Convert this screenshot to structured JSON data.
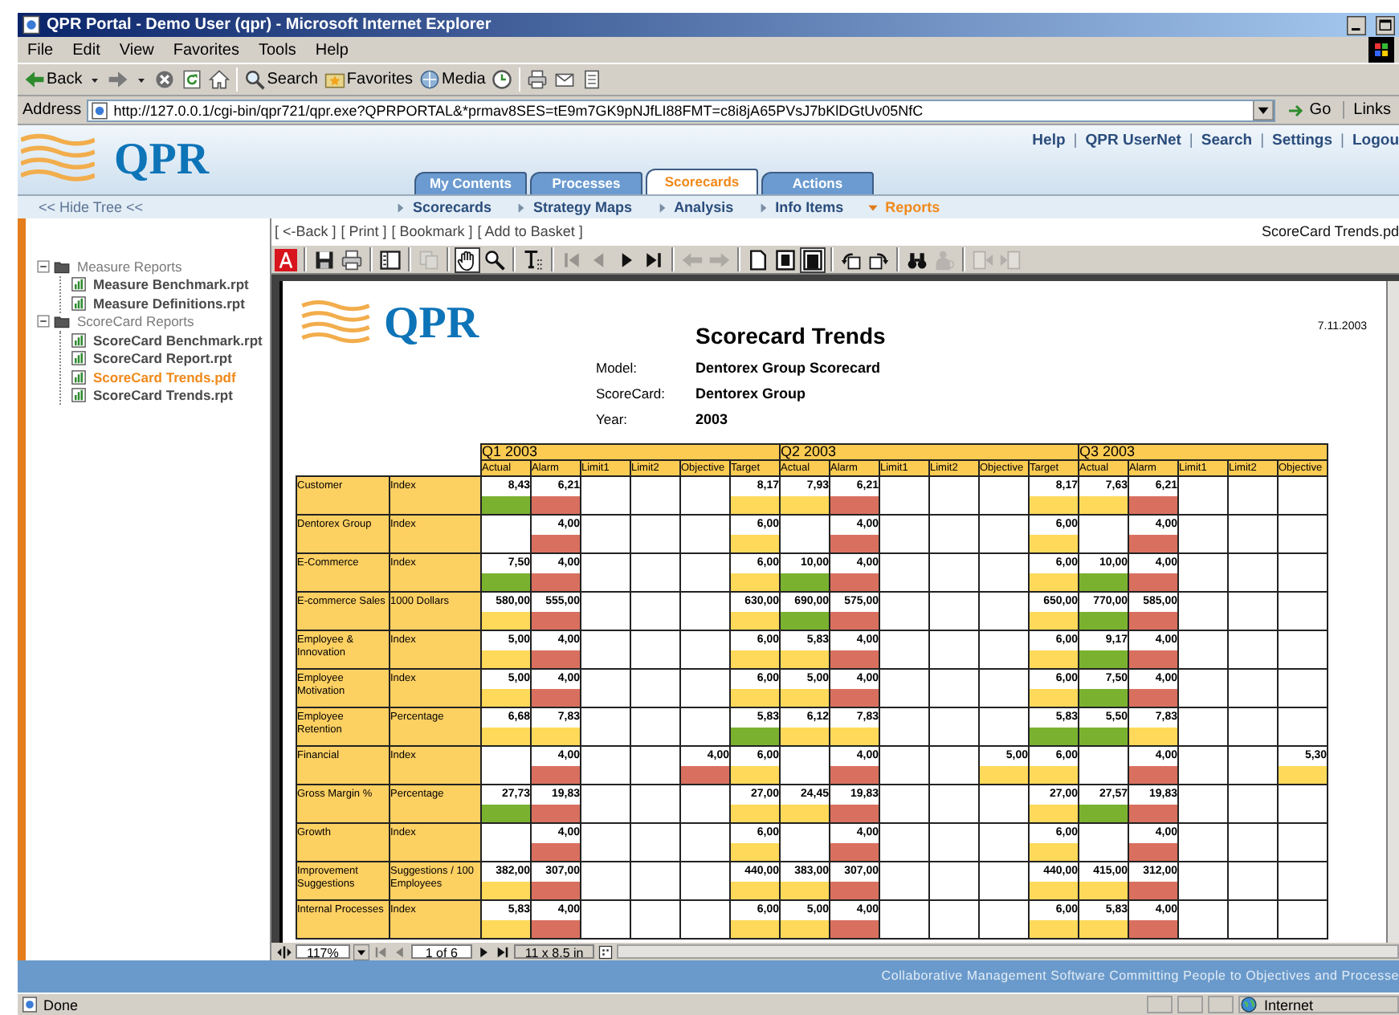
{
  "window": {
    "title": "QPR Portal - Demo User (qpr) - Microsoft Internet Explorer"
  },
  "menu": [
    "File",
    "Edit",
    "View",
    "Favorites",
    "Tools",
    "Help"
  ],
  "ie_toolbar": [
    {
      "kind": "back",
      "label": "Back"
    },
    {
      "kind": "forward"
    },
    {
      "kind": "stop"
    },
    {
      "kind": "refresh"
    },
    {
      "kind": "home"
    },
    {
      "kind": "search",
      "label": "Search"
    },
    {
      "kind": "favorites",
      "label": "Favorites"
    },
    {
      "kind": "media",
      "label": "Media"
    },
    {
      "kind": "history"
    },
    {
      "kind": "print"
    },
    {
      "kind": "mail"
    },
    {
      "kind": "edit"
    }
  ],
  "address": {
    "label": "Address",
    "url": "http://127.0.0.1/cgi-bin/qpr721/qpr.exe?QPRPORTAL&*prmav8SES=tE9m7GK9pNJfLI88FMT=c8i8jA65PVsJ7bKlDGtUv05NfC",
    "go": "Go",
    "links": "Links"
  },
  "portal": {
    "logo": "QPR",
    "links": [
      {
        "kind": "link",
        "label": "Help"
      },
      {
        "kind": "sep",
        "label": "|"
      },
      {
        "kind": "link",
        "label": "QPR UserNet"
      },
      {
        "kind": "sep",
        "label": "|"
      },
      {
        "kind": "link",
        "label": "Search"
      },
      {
        "kind": "sep",
        "label": "|"
      },
      {
        "kind": "link",
        "label": "Settings"
      },
      {
        "kind": "sep",
        "label": "|"
      },
      {
        "kind": "link",
        "label": "Logou"
      }
    ],
    "tabs": [
      {
        "label": "My Contents",
        "selected": false
      },
      {
        "label": "Processes",
        "selected": false
      },
      {
        "label": "Scorecards",
        "selected": true
      },
      {
        "label": "Actions",
        "selected": false
      }
    ],
    "hide_tree": "<< Hide Tree <<",
    "subnav": [
      {
        "label": "Scorecards",
        "selected": false
      },
      {
        "label": "Strategy Maps",
        "selected": false
      },
      {
        "label": "Analysis",
        "selected": false
      },
      {
        "label": "Info Items",
        "selected": false
      },
      {
        "label": "Reports",
        "selected": true
      }
    ]
  },
  "tree": [
    {
      "label": "Measure Reports",
      "expanded": true,
      "children": [
        {
          "label": "Measure Benchmark.rpt",
          "selected": false
        },
        {
          "label": "Measure Definitions.rpt",
          "selected": false
        }
      ]
    },
    {
      "label": "ScoreCard Reports",
      "expanded": true,
      "children": [
        {
          "label": "ScoreCard Benchmark.rpt",
          "selected": false
        },
        {
          "label": "ScoreCard Report.rpt",
          "selected": false
        },
        {
          "label": "ScoreCard Trends.pdf",
          "selected": true
        },
        {
          "label": "ScoreCard Trends.rpt",
          "selected": false
        }
      ]
    }
  ],
  "viewer": {
    "links": [
      "[ <-Back ]",
      "[ Print ]",
      "[ Bookmark ]",
      "[ Add to Basket ]"
    ],
    "file": "ScoreCard Trends.pd",
    "toolbar": [
      {
        "kind": "acrobat",
        "disabled": false,
        "pressed": false
      },
      {
        "kind": "sep"
      },
      {
        "kind": "save",
        "disabled": false,
        "pressed": false
      },
      {
        "kind": "print",
        "disabled": false,
        "pressed": false
      },
      {
        "kind": "sep"
      },
      {
        "kind": "panel",
        "disabled": false,
        "pressed": false
      },
      {
        "kind": "sep"
      },
      {
        "kind": "copy",
        "disabled": true,
        "pressed": false
      },
      {
        "kind": "sep"
      },
      {
        "kind": "hand",
        "disabled": false,
        "pressed": true
      },
      {
        "kind": "zoom",
        "disabled": false,
        "pressed": false
      },
      {
        "kind": "sep"
      },
      {
        "kind": "textselect",
        "disabled": false,
        "pressed": false
      },
      {
        "kind": "sep"
      },
      {
        "kind": "first",
        "disabled": true,
        "pressed": false
      },
      {
        "kind": "prev",
        "disabled": true,
        "pressed": false
      },
      {
        "kind": "next",
        "disabled": false,
        "pressed": false
      },
      {
        "kind": "last",
        "disabled": false,
        "pressed": false
      },
      {
        "kind": "sep"
      },
      {
        "kind": "goback",
        "disabled": true,
        "pressed": false
      },
      {
        "kind": "goforward",
        "disabled": true,
        "pressed": false
      },
      {
        "kind": "sep"
      },
      {
        "kind": "actual",
        "disabled": false,
        "pressed": false
      },
      {
        "kind": "fitpage",
        "disabled": false,
        "pressed": false
      },
      {
        "kind": "fitwidth",
        "disabled": false,
        "pressed": true
      },
      {
        "kind": "sep"
      },
      {
        "kind": "rotl",
        "disabled": false,
        "pressed": false
      },
      {
        "kind": "rotr",
        "disabled": false,
        "pressed": false
      },
      {
        "kind": "sep"
      },
      {
        "kind": "find",
        "disabled": false,
        "pressed": false
      },
      {
        "kind": "person",
        "disabled": true,
        "pressed": false
      },
      {
        "kind": "sep"
      },
      {
        "kind": "read1",
        "disabled": true,
        "pressed": false
      },
      {
        "kind": "read2",
        "disabled": true,
        "pressed": false
      }
    ],
    "zoom": "117%",
    "page": "1 of 6",
    "size": "11 x 8.5 in"
  },
  "report": {
    "logo": "QPR",
    "title": "Scorecard Trends",
    "date": "7.11.2003",
    "fields": [
      {
        "label": "Model:",
        "value": "Dentorex Group Scorecard"
      },
      {
        "label": "ScoreCard:",
        "value": "Dentorex Group"
      },
      {
        "label": "Year:",
        "value": "2003"
      }
    ],
    "quarters": [
      {
        "label": "Q1 2003",
        "columns": [
          "Actual",
          "Alarm",
          "Limit1",
          "Limit2",
          "Objective",
          "Target"
        ]
      },
      {
        "label": "Q2 2003",
        "columns": [
          "Actual",
          "Alarm",
          "Limit1",
          "Limit2",
          "Objective",
          "Target"
        ]
      },
      {
        "label": "Q3 2003",
        "columns": [
          "Actual",
          "Alarm",
          "Limit1",
          "Limit2",
          "Objective"
        ]
      }
    ],
    "rows": [
      {
        "measure": "Customer",
        "unit": "Index",
        "cells": [
          {
            "value": "8,43",
            "color": "#7ab230"
          },
          {
            "value": "6,21",
            "color": "#d9705f"
          },
          null,
          null,
          null,
          {
            "value": "8,17",
            "color": "#ffd95a"
          },
          {
            "value": "7,93",
            "color": "#ffd95a"
          },
          {
            "value": "6,21",
            "color": "#d9705f"
          },
          null,
          null,
          null,
          {
            "value": "8,17",
            "color": "#ffd95a"
          },
          {
            "value": "7,63",
            "color": "#ffd95a"
          },
          {
            "value": "6,21",
            "color": "#d9705f"
          },
          null,
          null,
          null
        ]
      },
      {
        "measure": "Dentorex Group",
        "unit": "Index",
        "cells": [
          null,
          {
            "value": "4,00",
            "color": "#d9705f"
          },
          null,
          null,
          null,
          {
            "value": "6,00",
            "color": "#ffd95a"
          },
          null,
          {
            "value": "4,00",
            "color": "#d9705f"
          },
          null,
          null,
          null,
          {
            "value": "6,00",
            "color": "#ffd95a"
          },
          null,
          {
            "value": "4,00",
            "color": "#d9705f"
          },
          null,
          null,
          null
        ]
      },
      {
        "measure": "E-Commerce",
        "unit": "Index",
        "cells": [
          {
            "value": "7,50",
            "color": "#7ab230"
          },
          {
            "value": "4,00",
            "color": "#d9705f"
          },
          null,
          null,
          null,
          {
            "value": "6,00",
            "color": "#ffd95a"
          },
          {
            "value": "10,00",
            "color": "#7ab230"
          },
          {
            "value": "4,00",
            "color": "#d9705f"
          },
          null,
          null,
          null,
          {
            "value": "6,00",
            "color": "#ffd95a"
          },
          {
            "value": "10,00",
            "color": "#7ab230"
          },
          {
            "value": "4,00",
            "color": "#d9705f"
          },
          null,
          null,
          null
        ]
      },
      {
        "measure": "E-commerce Sales",
        "unit": "1000 Dollars",
        "cells": [
          {
            "value": "580,00",
            "color": "#ffd95a"
          },
          {
            "value": "555,00",
            "color": "#d9705f"
          },
          null,
          null,
          null,
          {
            "value": "630,00",
            "color": "#ffd95a"
          },
          {
            "value": "690,00",
            "color": "#7ab230"
          },
          {
            "value": "575,00",
            "color": "#d9705f"
          },
          null,
          null,
          null,
          {
            "value": "650,00",
            "color": "#ffd95a"
          },
          {
            "value": "770,00",
            "color": "#7ab230"
          },
          {
            "value": "585,00",
            "color": "#d9705f"
          },
          null,
          null,
          null
        ]
      },
      {
        "measure": "Employee & Innovation",
        "unit": "Index",
        "cells": [
          {
            "value": "5,00",
            "color": "#ffd95a"
          },
          {
            "value": "4,00",
            "color": "#d9705f"
          },
          null,
          null,
          null,
          {
            "value": "6,00",
            "color": "#ffd95a"
          },
          {
            "value": "5,83",
            "color": "#ffd95a"
          },
          {
            "value": "4,00",
            "color": "#d9705f"
          },
          null,
          null,
          null,
          {
            "value": "6,00",
            "color": "#ffd95a"
          },
          {
            "value": "9,17",
            "color": "#7ab230"
          },
          {
            "value": "4,00",
            "color": "#d9705f"
          },
          null,
          null,
          null
        ]
      },
      {
        "measure": "Employee Motivation",
        "unit": "Index",
        "cells": [
          {
            "value": "5,00",
            "color": "#ffd95a"
          },
          {
            "value": "4,00",
            "color": "#d9705f"
          },
          null,
          null,
          null,
          {
            "value": "6,00",
            "color": "#ffd95a"
          },
          {
            "value": "5,00",
            "color": "#ffd95a"
          },
          {
            "value": "4,00",
            "color": "#d9705f"
          },
          null,
          null,
          null,
          {
            "value": "6,00",
            "color": "#ffd95a"
          },
          {
            "value": "7,50",
            "color": "#7ab230"
          },
          {
            "value": "4,00",
            "color": "#d9705f"
          },
          null,
          null,
          null
        ]
      },
      {
        "measure": "Employee Retention",
        "unit": "Percentage",
        "cells": [
          {
            "value": "6,68",
            "color": "#ffd95a"
          },
          {
            "value": "7,83",
            "color": "#ffd95a"
          },
          null,
          null,
          null,
          {
            "value": "5,83",
            "color": "#7ab230"
          },
          {
            "value": "6,12",
            "color": "#ffd95a"
          },
          {
            "value": "7,83",
            "color": "#ffd95a"
          },
          null,
          null,
          null,
          {
            "value": "5,83",
            "color": "#7ab230"
          },
          {
            "value": "5,50",
            "color": "#7ab230"
          },
          {
            "value": "7,83",
            "color": "#ffd95a"
          },
          null,
          null,
          null
        ]
      },
      {
        "measure": "Financial",
        "unit": "Index",
        "cells": [
          null,
          {
            "value": "4,00",
            "color": "#d9705f"
          },
          null,
          null,
          {
            "value": "4,00",
            "color": "#d9705f"
          },
          {
            "value": "6,00",
            "color": "#ffd95a"
          },
          null,
          {
            "value": "4,00",
            "color": "#d9705f"
          },
          null,
          null,
          {
            "value": "5,00",
            "color": "#ffd95a"
          },
          {
            "value": "6,00",
            "color": "#ffd95a"
          },
          null,
          {
            "value": "4,00",
            "color": "#d9705f"
          },
          null,
          null,
          {
            "value": "5,30",
            "color": "#ffd95a"
          }
        ]
      },
      {
        "measure": "Gross Margin %",
        "unit": "Percentage",
        "cells": [
          {
            "value": "27,73",
            "color": "#7ab230"
          },
          {
            "value": "19,83",
            "color": "#d9705f"
          },
          null,
          null,
          null,
          {
            "value": "27,00",
            "color": "#ffd95a"
          },
          {
            "value": "24,45",
            "color": "#ffd95a"
          },
          {
            "value": "19,83",
            "color": "#d9705f"
          },
          null,
          null,
          null,
          {
            "value": "27,00",
            "color": "#ffd95a"
          },
          {
            "value": "27,57",
            "color": "#7ab230"
          },
          {
            "value": "19,83",
            "color": "#d9705f"
          },
          null,
          null,
          null
        ]
      },
      {
        "measure": "Growth",
        "unit": "Index",
        "cells": [
          null,
          {
            "value": "4,00",
            "color": "#d9705f"
          },
          null,
          null,
          null,
          {
            "value": "6,00",
            "color": "#ffd95a"
          },
          null,
          {
            "value": "4,00",
            "color": "#d9705f"
          },
          null,
          null,
          null,
          {
            "value": "6,00",
            "color": "#ffd95a"
          },
          null,
          {
            "value": "4,00",
            "color": "#d9705f"
          },
          null,
          null,
          null
        ]
      },
      {
        "measure": "Improvement Suggestions",
        "unit": "Suggestions / 100 Employees",
        "cells": [
          {
            "value": "382,00",
            "color": "#ffd95a"
          },
          {
            "value": "307,00",
            "color": "#d9705f"
          },
          null,
          null,
          null,
          {
            "value": "440,00",
            "color": "#ffd95a"
          },
          {
            "value": "383,00",
            "color": "#ffd95a"
          },
          {
            "value": "307,00",
            "color": "#d9705f"
          },
          null,
          null,
          null,
          {
            "value": "440,00",
            "color": "#ffd95a"
          },
          {
            "value": "415,00",
            "color": "#ffd95a"
          },
          {
            "value": "312,00",
            "color": "#d9705f"
          },
          null,
          null,
          null
        ]
      },
      {
        "measure": "Internal Processes",
        "unit": "Index",
        "cells": [
          {
            "value": "5,83",
            "color": "#ffd95a"
          },
          {
            "value": "4,00",
            "color": "#d9705f"
          },
          null,
          null,
          null,
          {
            "value": "6,00",
            "color": "#ffd95a"
          },
          {
            "value": "5,00",
            "color": "#ffd95a"
          },
          {
            "value": "4,00",
            "color": "#d9705f"
          },
          null,
          null,
          null,
          {
            "value": "6,00",
            "color": "#ffd95a"
          },
          {
            "value": "5,83",
            "color": "#ffd95a"
          },
          {
            "value": "4,00",
            "color": "#d9705f"
          },
          null,
          null,
          null
        ]
      }
    ]
  },
  "footer": "Collaborative Management Software Committing People to Objectives and Processe",
  "status": {
    "text": "Done",
    "zone": "Internet"
  }
}
